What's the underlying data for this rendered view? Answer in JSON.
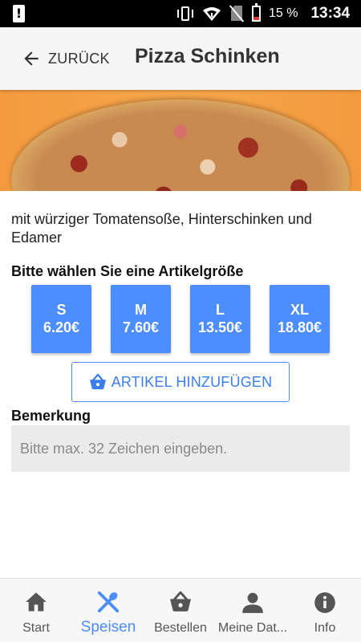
{
  "status_bar": {
    "battery_percent": "15 %",
    "time": "13:34",
    "icons": [
      "alert-icon",
      "vibrate-icon",
      "wifi-icon",
      "no-sim-icon",
      "battery-icon"
    ]
  },
  "header": {
    "back_label": "ZURÜCK",
    "title": "Pizza Schinken"
  },
  "product": {
    "description": "mit würziger Tomatensoße, Hinterschinken und Edamer",
    "size_heading": "Bitte wählen Sie eine Artikelgröße",
    "sizes": [
      {
        "name": "S",
        "price": "6.20€"
      },
      {
        "name": "M",
        "price": "7.60€"
      },
      {
        "name": "L",
        "price": "13.50€"
      },
      {
        "name": "XL",
        "price": "18.80€"
      }
    ],
    "add_button_label": "ARTIKEL HINZUFÜGEN",
    "remark_label": "Bemerkung",
    "remark_placeholder": "Bitte max. 32 Zeichen eingeben.",
    "remark_value": ""
  },
  "bottom_nav": {
    "items": [
      {
        "label": "Start",
        "icon": "home-icon"
      },
      {
        "label": "Speisen",
        "icon": "cutlery-icon",
        "active": true
      },
      {
        "label": "Bestellen",
        "icon": "basket-icon"
      },
      {
        "label": "Meine Dat...",
        "icon": "person-icon"
      },
      {
        "label": "Info",
        "icon": "info-icon"
      }
    ]
  },
  "colors": {
    "accent": "#4c8dff",
    "header_bg": "#f5f5f5",
    "hero_bg": "#f39a3f"
  }
}
